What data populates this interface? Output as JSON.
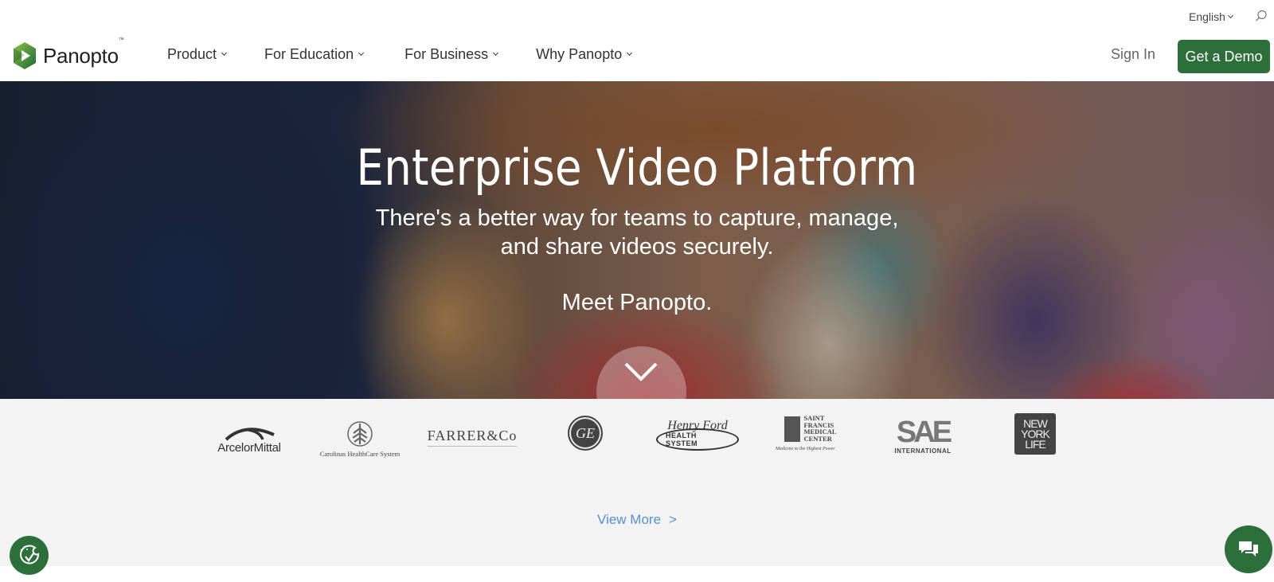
{
  "utility": {
    "language": "English",
    "search_icon": "search-icon"
  },
  "nav": {
    "logo_text": "Panopto",
    "logo_tm": "™",
    "items": [
      {
        "label": "Product"
      },
      {
        "label": "For Education"
      },
      {
        "label": "For Business"
      },
      {
        "label": "Why Panopto"
      }
    ],
    "sign_in": "Sign In",
    "demo_button": "Get a Demo"
  },
  "hero": {
    "title": "Enterprise Video Platform",
    "subtitle_line1": "There's a better way for teams to capture, manage,",
    "subtitle_line2": "and share videos securely.",
    "meet": "Meet Panopto.",
    "scroll_icon": "chevron-down-icon"
  },
  "logos": {
    "items": [
      {
        "name": "ArcelorMittal",
        "text": "ArcelorMittal"
      },
      {
        "name": "Carolinas HealthCare System",
        "text": "Carolinas HealthCare System"
      },
      {
        "name": "Farrer & Co",
        "text": "FARRER&Co"
      },
      {
        "name": "GE",
        "text": "GE"
      },
      {
        "name": "Henry Ford Health System",
        "script": "Henry Ford",
        "text": "HEALTH SYSTEM"
      },
      {
        "name": "Saint Francis Medical Center",
        "lines": [
          "SAINT",
          "FRANCIS",
          "MEDICAL",
          "CENTER"
        ],
        "tagline": "Medicine to the Highest Power"
      },
      {
        "name": "SAE International",
        "mark": "SAE",
        "text": "INTERNATIONAL"
      },
      {
        "name": "New York Life",
        "lines": [
          "NEW",
          "YORK",
          "LIFE"
        ]
      }
    ],
    "view_more": "View More",
    "view_more_arrow": ">"
  },
  "floating": {
    "cookie_icon": "cookie-consent-icon",
    "chat_icon": "chat-icon"
  },
  "colors": {
    "brand_green": "#2d6f3a",
    "link_blue": "#5b8fd0",
    "strip_bg": "#f3f3f3"
  }
}
